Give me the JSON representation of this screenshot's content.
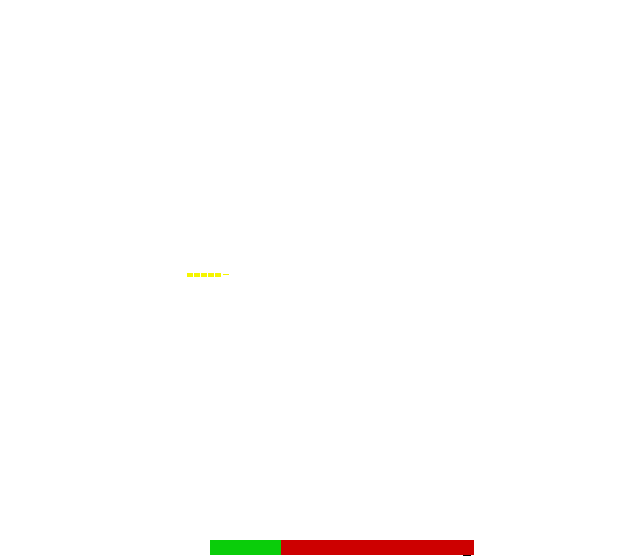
{
  "dash_indicator": {
    "color": "#f5f500",
    "segments": 6
  },
  "progress_bar": {
    "value": 0.27,
    "fill_color": "#0acd0a",
    "rest_color": "#cd0000"
  }
}
